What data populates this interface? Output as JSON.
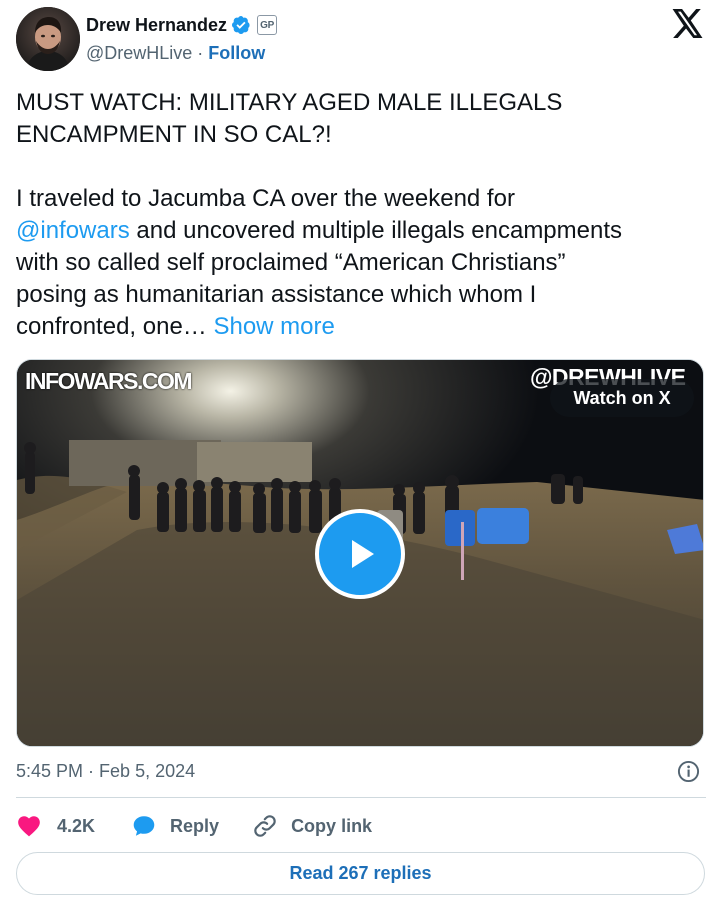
{
  "author": {
    "name": "Drew Hernandez",
    "handle": "@DrewHLive",
    "separator": "·",
    "follow_label": "Follow",
    "badge_label": "GP",
    "verified_icon": "verified-badge-icon"
  },
  "tweet": {
    "lines": [
      "MUST WATCH: MILITARY AGED MALE ILLEGALS",
      "ENCAMPMENT IN SO CAL?!",
      "",
      "I traveled to Jacumba CA over the weekend for",
      "and uncovered multiple illegals encampments",
      "with so called self proclaimed “American Christians”",
      "posing as humanitarian assistance which whom I",
      "confronted, one…"
    ],
    "mention": "@infowars",
    "show_more": "Show more"
  },
  "media": {
    "watermark_left": "INFOWARS.COM",
    "watermark_right": "@DREWHLIVE",
    "watch_label": "Watch on X",
    "play_icon": "play-icon"
  },
  "meta": {
    "time": "5:45 PM",
    "separator": "·",
    "date": "Feb 5, 2024",
    "info_icon": "info-icon"
  },
  "actions": {
    "like_count": "4.2K",
    "reply_label": "Reply",
    "copy_label": "Copy link",
    "read_replies": "Read 267 replies"
  },
  "colors": {
    "link": "#1d9bf0",
    "follow": "#1d6fb8",
    "like": "#f91880",
    "text": "#0f1419",
    "muted": "#536471",
    "border": "#cfd9de"
  }
}
